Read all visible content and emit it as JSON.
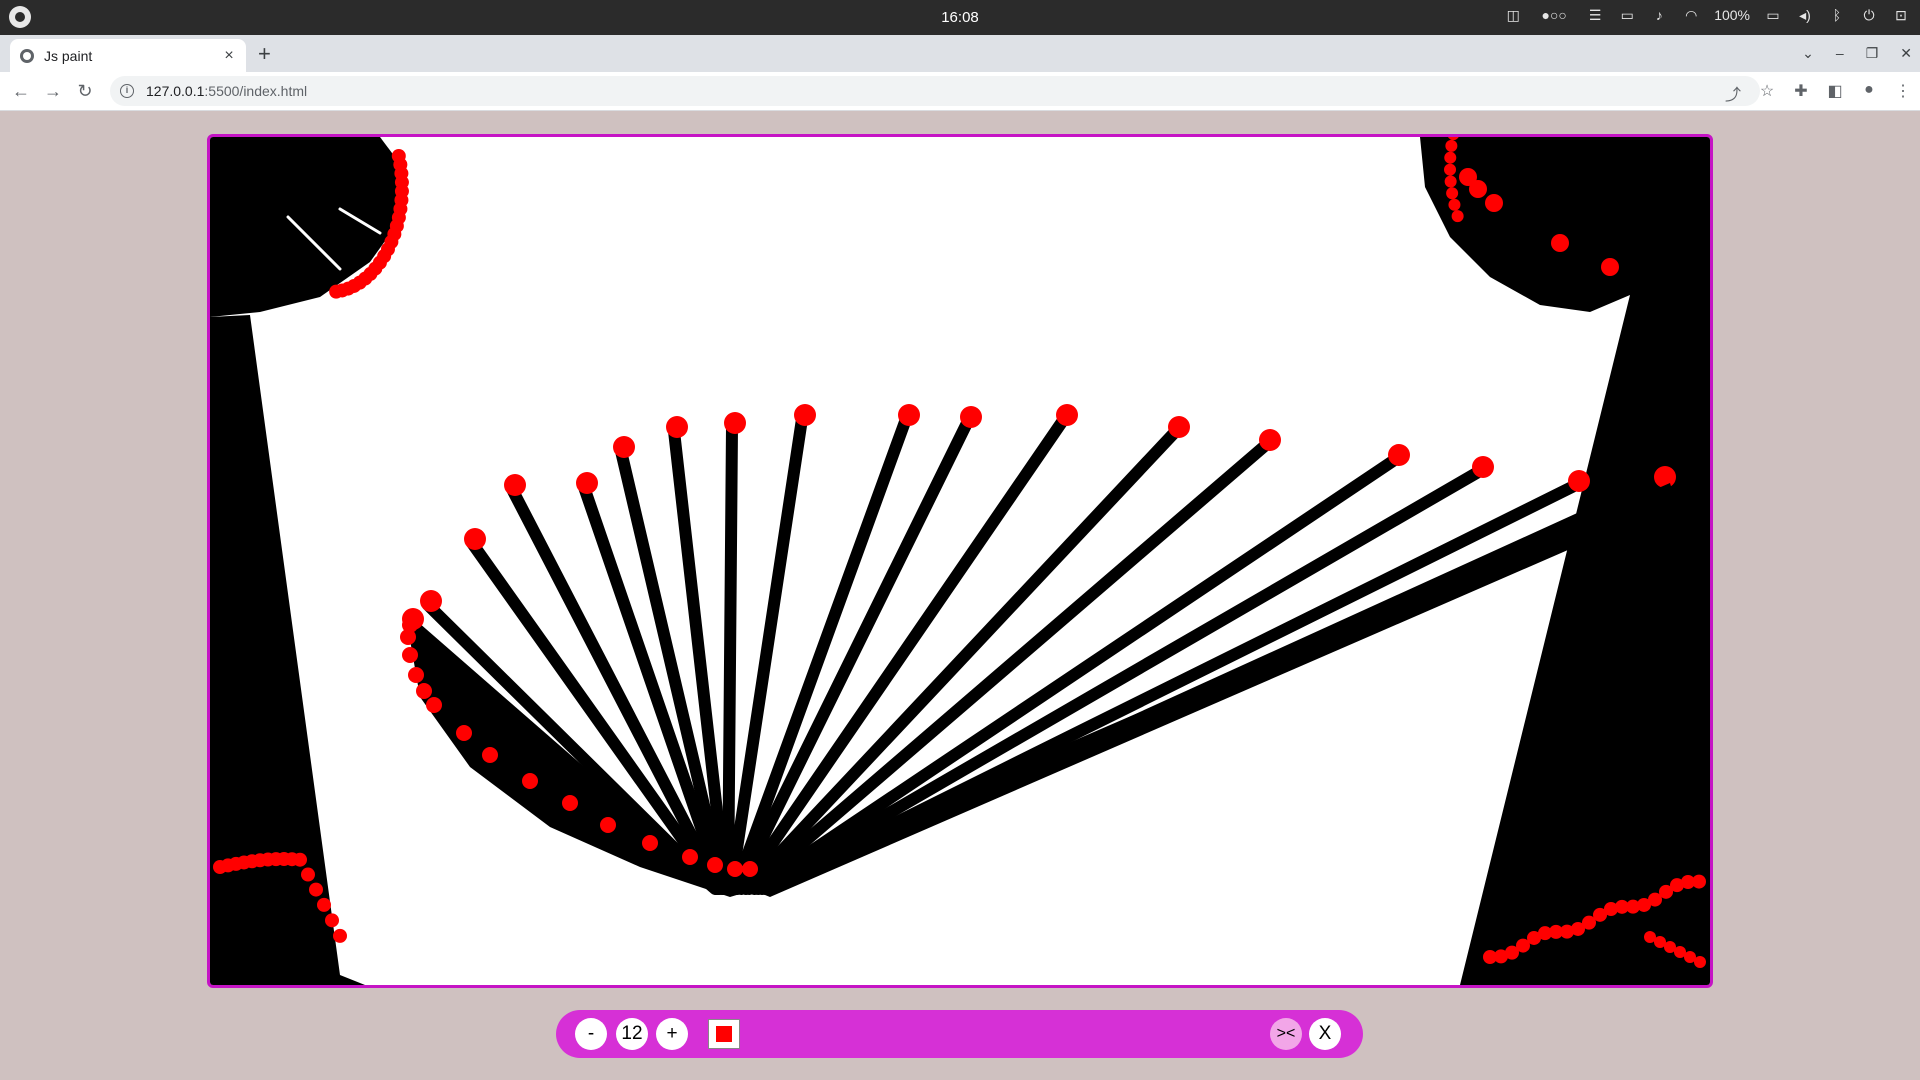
{
  "os": {
    "clock": "16:08",
    "battery": "100%"
  },
  "browser": {
    "tab_title": "Js paint",
    "tab_close": "×",
    "new_tab": "+",
    "url_host": "127.0.0.1",
    "url_path": ":5500/index.html"
  },
  "paint": {
    "minus_label": "-",
    "brush_size": "12",
    "plus_label": "+",
    "color": "#ff0000",
    "shrink_label": "><",
    "clear_label": "X",
    "canvas_border": "#c514c5",
    "toolbar_color": "#d630d6",
    "stroke_color": "#000000"
  }
}
